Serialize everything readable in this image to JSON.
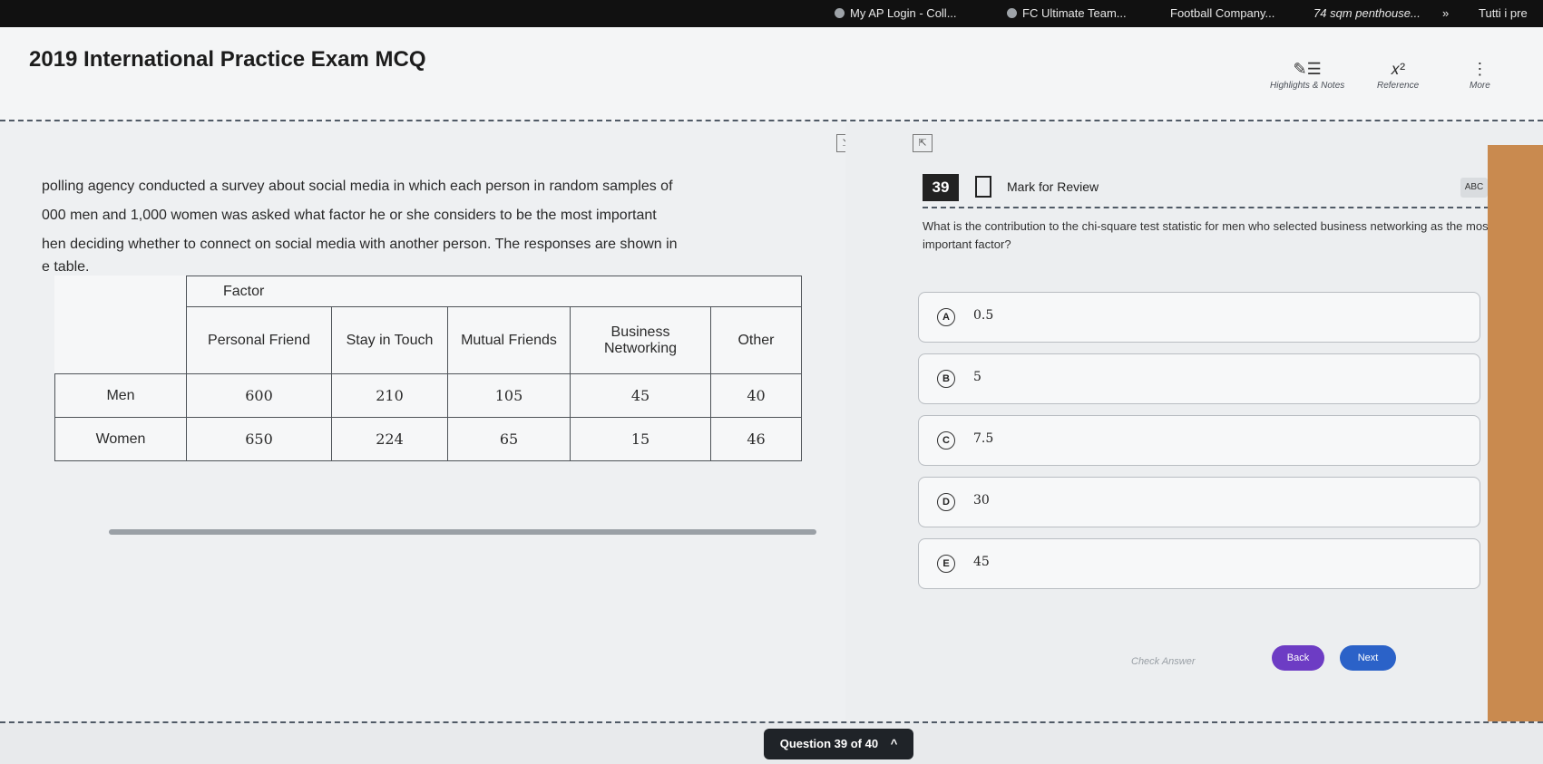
{
  "browser": {
    "bookmarks": [
      "My AP Login - Coll...",
      "FC Ultimate Team...",
      "Football Company...",
      "74 sqm penthouse...",
      "»",
      "Tutti i pre"
    ]
  },
  "header": {
    "title": "2019 International Practice Exam MCQ",
    "tools": [
      {
        "label": "Highlights & Notes",
        "icon": "highlight-icon"
      },
      {
        "label": "Reference",
        "icon": "formula-icon"
      },
      {
        "label": "More",
        "icon": "more-icon"
      }
    ],
    "tool_glyphs": [
      "✎☰",
      "𝑥²",
      "⋮"
    ]
  },
  "passage": {
    "line1": "polling agency conducted a survey about social media in which each person in random samples of",
    "line2": "000 men and 1,000 women was asked what factor he or she considers to be the most important",
    "line3": "hen deciding whether to connect on social media with another person. The responses are shown in",
    "line4": "e table.",
    "table": {
      "factor_label": "Factor",
      "columns": [
        "Personal Friend",
        "Stay in Touch",
        "Mutual Friends",
        "Business Networking",
        "Other"
      ],
      "rows": [
        {
          "label": "Men",
          "values": [
            "600",
            "210",
            "105",
            "45",
            "40"
          ]
        },
        {
          "label": "Women",
          "values": [
            "650",
            "224",
            "65",
            "15",
            "46"
          ]
        }
      ]
    }
  },
  "question": {
    "number": "39",
    "mark_label": "Mark for Review",
    "abc_label": "ABC",
    "text": "What is the contribution to the chi-square test statistic for men who selected business networking as the most important factor?",
    "choices": [
      {
        "letter": "A",
        "value": "0.5"
      },
      {
        "letter": "B",
        "value": "5"
      },
      {
        "letter": "C",
        "value": "7.5"
      },
      {
        "letter": "D",
        "value": "30"
      },
      {
        "letter": "E",
        "value": "45"
      }
    ],
    "check_answer": "Check Answer",
    "back": "Back",
    "next": "Next"
  },
  "footer": {
    "counter": "Question 39 of 40",
    "chevron": "^"
  },
  "colors": {
    "header_bg": "#f4f5f6",
    "dark_badge": "#222222",
    "nav_button": "#2b62c8",
    "back_button": "#6d3cc4"
  }
}
